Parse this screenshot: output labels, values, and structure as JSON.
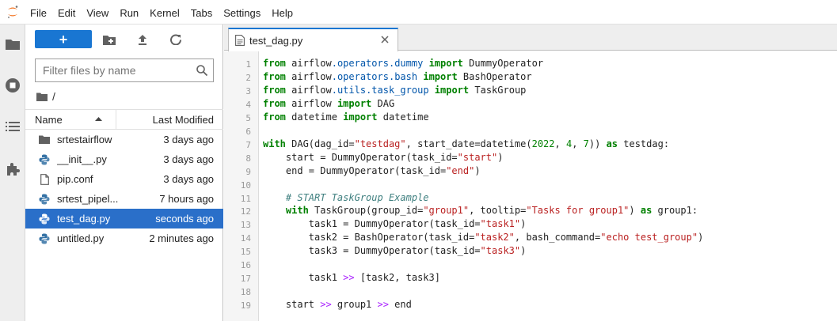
{
  "menu": [
    "File",
    "Edit",
    "View",
    "Run",
    "Kernel",
    "Tabs",
    "Settings",
    "Help"
  ],
  "activity_icons": [
    "folder-icon",
    "running-icon",
    "toc-icon",
    "extension-icon"
  ],
  "file_browser": {
    "new_button_label": "+",
    "filter_placeholder": "Filter files by name",
    "filter_value": "",
    "breadcrumb_root": "/",
    "columns": {
      "name": "Name",
      "modified": "Last Modified"
    },
    "files": [
      {
        "name": "srtestairflow",
        "modified": "3 days ago",
        "icon": "folder-icon",
        "selected": false
      },
      {
        "name": "__init__.py",
        "modified": "3 days ago",
        "icon": "python-icon",
        "selected": false
      },
      {
        "name": "pip.conf",
        "modified": "3 days ago",
        "icon": "file-icon",
        "selected": false
      },
      {
        "name": "srtest_pipel...",
        "modified": "7 hours ago",
        "icon": "python-icon",
        "selected": false
      },
      {
        "name": "test_dag.py",
        "modified": "seconds ago",
        "icon": "python-icon",
        "selected": true
      },
      {
        "name": "untitled.py",
        "modified": "2 minutes ago",
        "icon": "python-icon",
        "selected": false
      }
    ]
  },
  "editor": {
    "tab_title": "test_dag.py",
    "lines": [
      "from airflow.operators.dummy import DummyOperator",
      "from airflow.operators.bash import BashOperator",
      "from airflow.utils.task_group import TaskGroup",
      "from airflow import DAG",
      "from datetime import datetime",
      "",
      "with DAG(dag_id=\"testdag\", start_date=datetime(2022, 4, 7)) as testdag:",
      "    start = DummyOperator(task_id=\"start\")",
      "    end = DummyOperator(task_id=\"end\")",
      "",
      "    # START TaskGroup Example",
      "    with TaskGroup(group_id=\"group1\", tooltip=\"Tasks for group1\") as group1:",
      "        task1 = DummyOperator(task_id=\"task1\")",
      "        task2 = BashOperator(task_id=\"task2\", bash_command=\"echo test_group\")",
      "        task3 = DummyOperator(task_id=\"task3\")",
      "",
      "        task1 >> [task2, task3]",
      "",
      "    start >> group1 >> end"
    ]
  },
  "colors": {
    "accent": "#1976d2",
    "selected_row": "#2a6fc9",
    "keyword": "#008000",
    "string": "#ba2121",
    "module": "#0055aa",
    "operator": "#aa22ff",
    "comment": "#408080"
  }
}
